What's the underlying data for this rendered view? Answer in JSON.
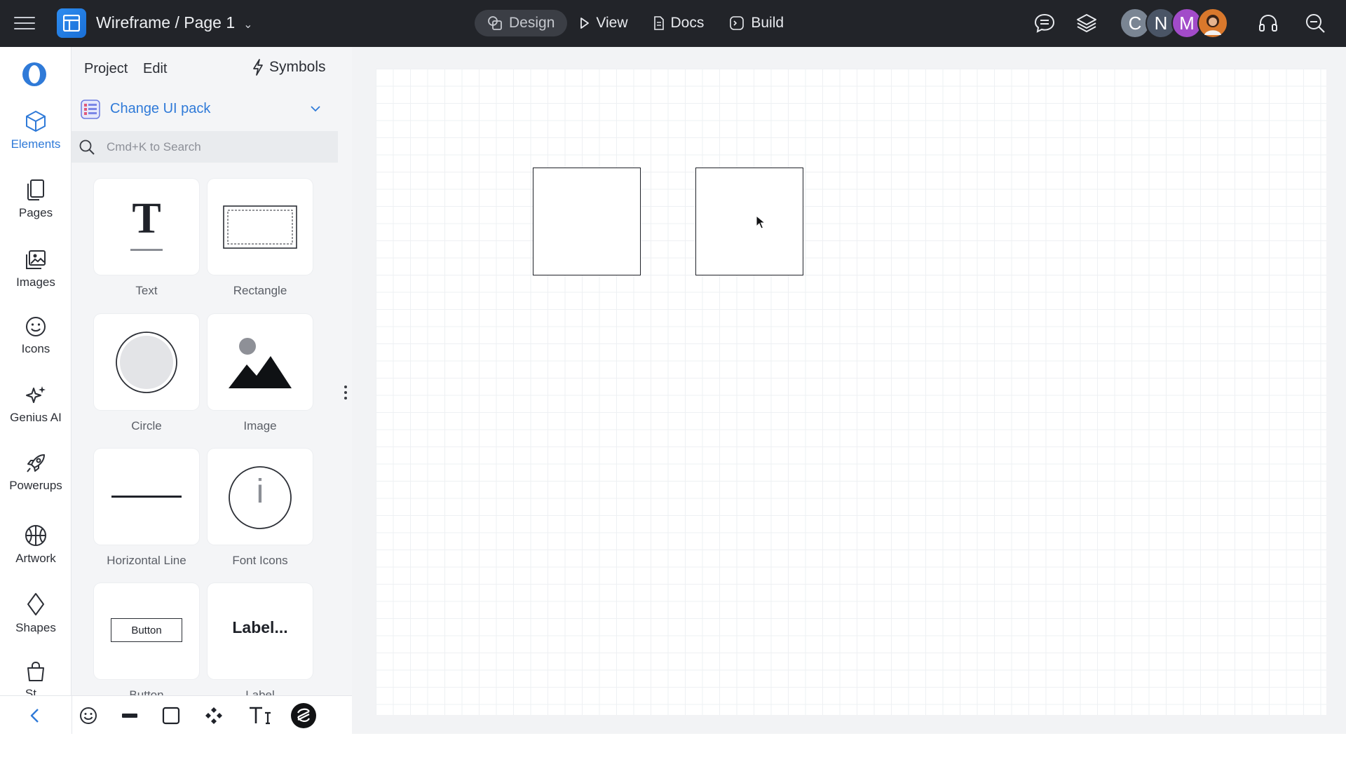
{
  "topbar": {
    "project_title": "Wireframe / Page 1",
    "modes": [
      {
        "label": "Design",
        "icon": "design-shapes-icon",
        "active": true
      },
      {
        "label": "View",
        "icon": "play-icon"
      },
      {
        "label": "Docs",
        "icon": "document-icon"
      },
      {
        "label": "Build",
        "icon": "code-terminal-icon"
      }
    ],
    "right_icons": [
      "comment-icon",
      "layers-icon",
      "headset-icon",
      "search-zoom-icon"
    ],
    "avatars": [
      {
        "initial": "C",
        "color": "#7a8593"
      },
      {
        "initial": "N",
        "color": "#4a5566"
      },
      {
        "initial": "M",
        "color": "#a24bc9"
      },
      {
        "initial": "",
        "color": "#d9782c"
      }
    ]
  },
  "rail": {
    "items": [
      {
        "label": "Elements",
        "icon": "cube-icon",
        "active": true
      },
      {
        "label": "Pages",
        "icon": "pages-icon"
      },
      {
        "label": "Images",
        "icon": "images-icon"
      },
      {
        "label": "Icons",
        "icon": "smiley-icon"
      },
      {
        "label": "Genius AI",
        "icon": "sparkles-icon"
      },
      {
        "label": "Powerups",
        "icon": "rocket-icon"
      },
      {
        "label": "Artwork",
        "icon": "basketball-icon"
      },
      {
        "label": "Shapes",
        "icon": "diamond-icon"
      },
      {
        "label": "St...",
        "icon": "bag-icon"
      }
    ]
  },
  "panel": {
    "tabs": [
      "Project",
      "Edit"
    ],
    "symbols_label": "Symbols",
    "ui_pack_label": "Change UI pack",
    "search_placeholder": "Cmd+K to Search",
    "elements": [
      {
        "label": "Text",
        "preview": "T"
      },
      {
        "label": "Rectangle"
      },
      {
        "label": "Circle"
      },
      {
        "label": "Image"
      },
      {
        "label": "Horizontal Line"
      },
      {
        "label": "Font Icons",
        "preview": "i"
      },
      {
        "label": "Button",
        "preview": "Button"
      },
      {
        "label": "Label",
        "preview": "Label..."
      }
    ]
  },
  "bottombar": {
    "icons": [
      "back-arrow-icon",
      "emoji-icon",
      "line-tool-icon",
      "square-tool-icon",
      "component-icon",
      "text-tool-icon",
      "stencil-icon"
    ]
  },
  "canvas": {
    "shapes": [
      "Rectangle",
      "Rectangle"
    ]
  }
}
